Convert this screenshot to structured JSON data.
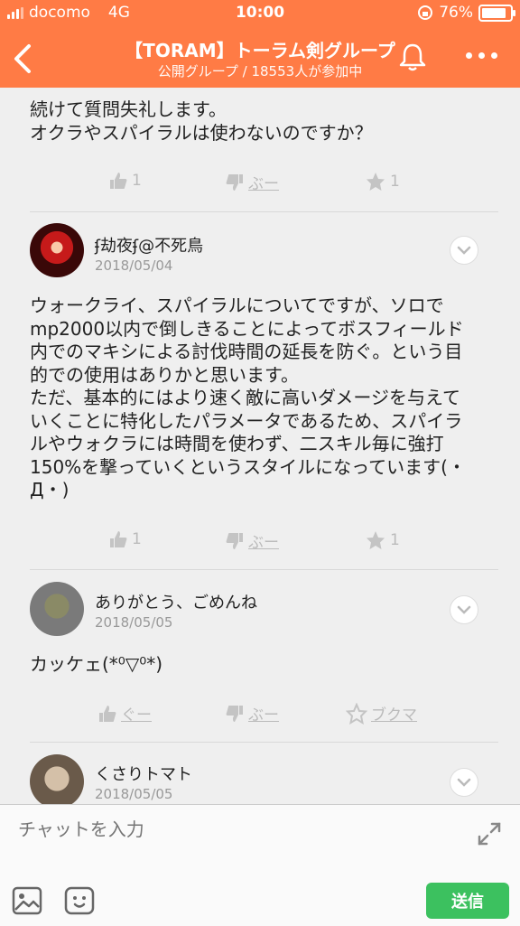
{
  "status_bar": {
    "carrier": "docomo",
    "network": "4G",
    "time": "10:00",
    "battery": "76%"
  },
  "header": {
    "title": "【TORAM】トーラム剣グループ",
    "subtitle": "公開グループ / 18553人が参加中"
  },
  "messages": [
    {
      "body": "続けて質問失礼します。\nオクラやスパイラルは使わないのですか？",
      "actions": {
        "like": "1",
        "dislike": "ぶー",
        "star": "1"
      }
    },
    {
      "user": "ʄ劫夜ʄ@不死鳥",
      "date": "2018/05/04",
      "body": "ウォークライ、スパイラルについてですが、ソロで\nmp2000以内で倒しきることによってボスフィールド\n内でのマキシによる討伐時間の延長を防ぐ。という目\n的での使用はありかと思います。\nただ、基本的にはより速く敵に高いダメージを与えて\nいくことに特化したパラメータであるため、スパイラ\nルやウォクラには時間を使わず、二スキル毎に強打\n150%を撃っていくというスタイルになっています(・\nД・)",
      "actions": {
        "like": "1",
        "dislike": "ぶー",
        "star": "1"
      }
    },
    {
      "user": "ありがとう、ごめんね",
      "date": "2018/05/05",
      "body": "カッケェ(*⁰▽⁰*)",
      "actions": {
        "like": "ぐー",
        "dislike": "ぶー",
        "star": "ブクマ"
      }
    },
    {
      "user": "くさりトマト",
      "date": "2018/05/05"
    }
  ],
  "input": {
    "placeholder": "チャットを入力"
  },
  "send_label": "送信",
  "colors": {
    "accent": "#ff7b45",
    "send": "#3cc15f"
  }
}
